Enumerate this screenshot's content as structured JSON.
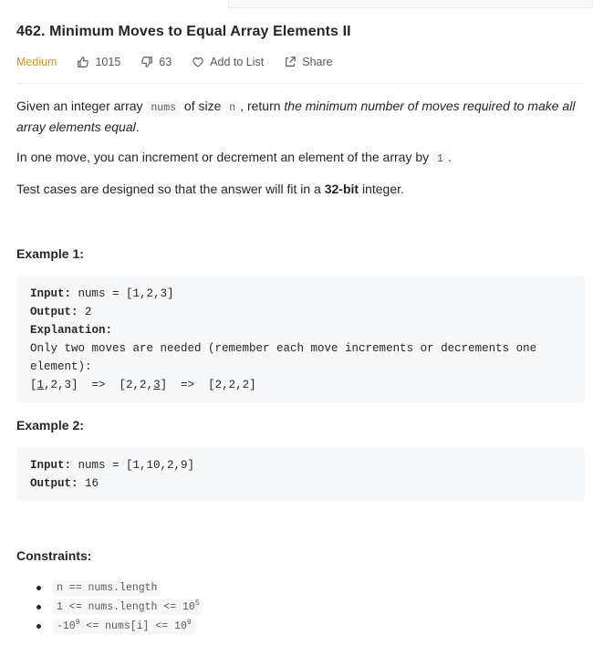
{
  "problem": {
    "title": "462. Minimum Moves to Equal Array Elements II",
    "difficulty": "Medium",
    "likes": "1015",
    "dislikes": "63",
    "add_to_list_label": "Add to List",
    "share_label": "Share"
  },
  "description": {
    "p1_prefix": "Given an integer array ",
    "p1_code1": "nums",
    "p1_mid1": " of size ",
    "p1_code2": "n",
    "p1_mid2": ", return ",
    "p1_emph": "the minimum number of moves required to make all array elements equal",
    "p1_suffix": ".",
    "p2_prefix": "In one move, you can increment or decrement an element of the array by ",
    "p2_code": "1",
    "p2_suffix": ".",
    "p3_prefix": "Test cases are designed so that the answer will fit in a ",
    "p3_bold": "32-bit",
    "p3_suffix": " integer."
  },
  "examples": [
    {
      "heading": "Example 1:",
      "input_label": "Input:",
      "input_value": " nums = [1,2,3]",
      "output_label": "Output:",
      "output_value": " 2",
      "explanation_label": "Explanation:",
      "explanation_text": "Only two moves are needed (remember each move increments or decrements one element):",
      "steps_a": "[",
      "steps_u1": "1",
      "steps_b": ",2,3]  =>  [2,2,",
      "steps_u2": "3",
      "steps_c": "]  =>  [2,2,2]"
    },
    {
      "heading": "Example 2:",
      "input_label": "Input:",
      "input_value": " nums = [1,10,2,9]",
      "output_label": "Output:",
      "output_value": " 16"
    }
  ],
  "constraints": {
    "heading": "Constraints:",
    "c1": "n == nums.length",
    "c2_base": "1 <= nums.length <= 10",
    "c2_exp": "5",
    "c3_base1": "-10",
    "c3_exp1": "9",
    "c3_mid": " <= nums[i] <= 10",
    "c3_exp2": "9"
  },
  "colors": {
    "difficulty_medium": "#ef8f00",
    "code_bg": "#f7f8fa"
  },
  "icons": [
    "thumbs-up-icon",
    "thumbs-down-icon",
    "heart-icon",
    "share-icon"
  ]
}
